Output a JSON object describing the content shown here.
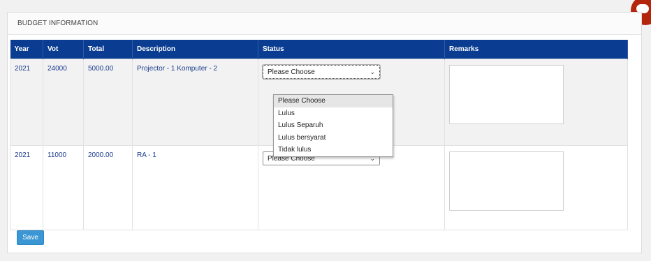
{
  "panel": {
    "title": "BUDGET INFORMATION"
  },
  "table": {
    "headers": [
      "Year",
      "Vot",
      "Total",
      "Description",
      "Status",
      "Remarks"
    ],
    "rows": [
      {
        "year": "2021",
        "vot": "24000",
        "total": "5000.00",
        "description": "Projector - 1 Komputer - 2",
        "status": "Please Choose",
        "remarks": ""
      },
      {
        "year": "2021",
        "vot": "11000",
        "total": "2000.00",
        "description": "RA - 1",
        "status": "Please Choose",
        "remarks": ""
      }
    ]
  },
  "status_dropdown": {
    "options": [
      "Please Choose",
      "Lulus",
      "Lulus Separuh",
      "Lulus bersyarat",
      "Tidak lulus"
    ],
    "selected": "Please Choose"
  },
  "save_label": "Save",
  "colors": {
    "header_bg": "#0a3d91",
    "save_button": "#3a97d4",
    "chat_bubble": "#b4260c",
    "link_text": "#1a3b8c"
  },
  "icons": {
    "select_arrow": "chevron-down-icon",
    "chat": "chat-icon"
  }
}
